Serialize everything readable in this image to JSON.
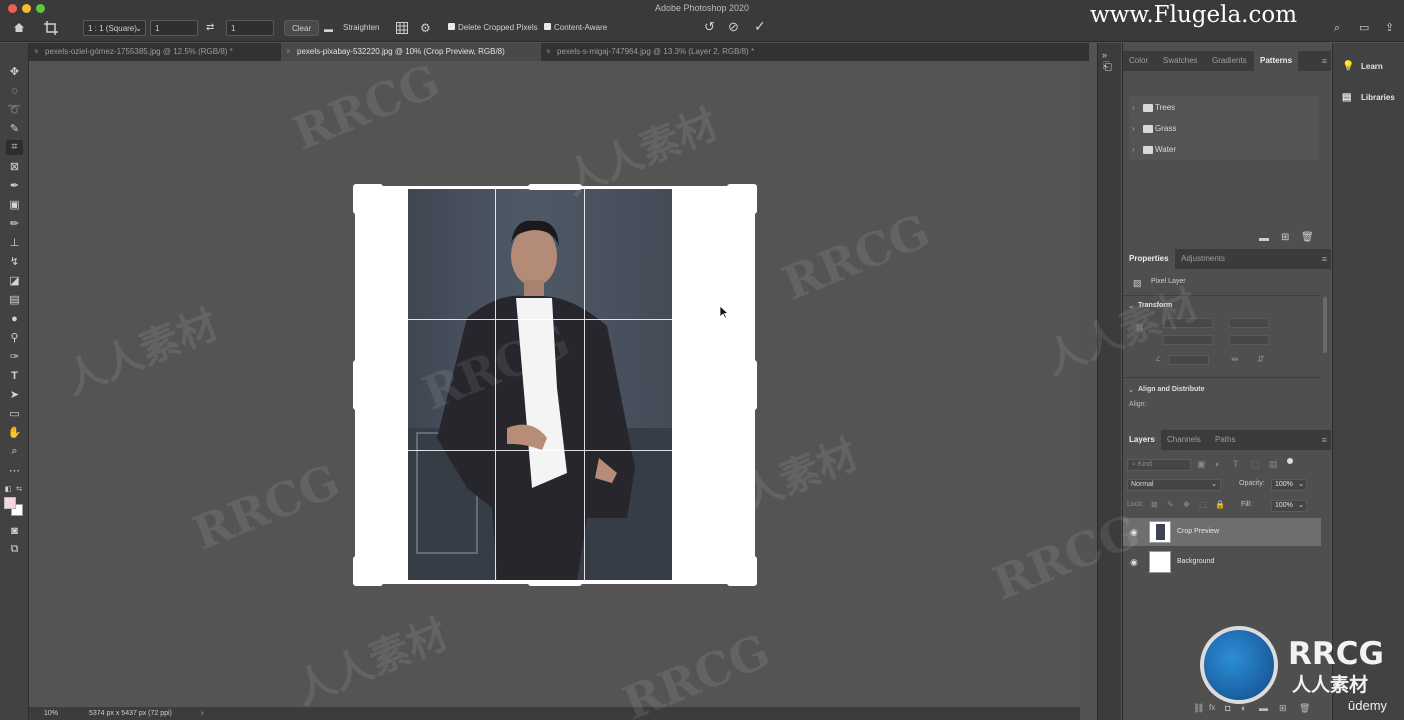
{
  "app": {
    "title": "Adobe Photoshop 2020",
    "watermark_url": "www.Flugela.com"
  },
  "options_bar": {
    "ratio_preset": "1 : 1 (Square)",
    "width_value": "1",
    "height_value": "1",
    "clear_label": "Clear",
    "straighten_label": "Straighten",
    "delete_cropped_label": "Delete Cropped Pixels",
    "content_aware_label": "Content-Aware"
  },
  "tabs": [
    {
      "label": "pexels-oziel-gómez-1755385.jpg @ 12.5% (RGB/8) *"
    },
    {
      "label": "pexels-pixabay-532220.jpg @ 10% (Crop Preview, RGB/8)"
    },
    {
      "label": "pexels-s-migaj-747964.jpg @ 13.3% (Layer 2, RGB/8) *"
    }
  ],
  "status_bar": {
    "zoom": "10%",
    "doc_info": "5374 px x 5437 px (72 ppi)"
  },
  "patterns_panel": {
    "tabs": [
      "Color",
      "Swatches",
      "Gradients",
      "Patterns"
    ],
    "active_tab": "Patterns",
    "groups": [
      "Trees",
      "Grass",
      "Water"
    ]
  },
  "properties_panel": {
    "tabs": [
      "Properties",
      "Adjustments"
    ],
    "layer_kind": "Pixel Layer",
    "transform_title": "Transform",
    "align_title": "Align and Distribute",
    "align_label": "Align:"
  },
  "layers_panel": {
    "tabs": [
      "Layers",
      "Channels",
      "Paths"
    ],
    "filter_label": "Kind",
    "blend_mode": "Normal",
    "opacity_label": "Opacity:",
    "opacity_value": "100%",
    "lock_label": "Lock:",
    "fill_label": "Fill:",
    "fill_value": "100%",
    "layers": [
      {
        "name": "Crop Preview",
        "selected": true
      },
      {
        "name": "Background",
        "selected": false
      }
    ]
  },
  "learn_libraries": {
    "learn": "Learn",
    "libraries": "Libraries"
  },
  "watermarks": {
    "rrcg": "RRCG",
    "cn": "人人素材",
    "udemy": "ūdemy"
  },
  "colors": {
    "foreground": "#f4d8de",
    "background": "#ffffff",
    "accent": "#2e8ed8"
  }
}
